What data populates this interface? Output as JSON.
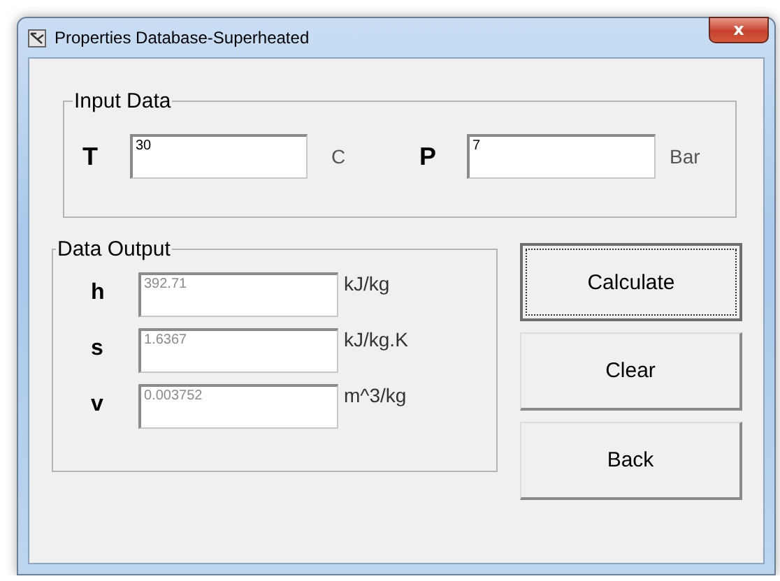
{
  "window": {
    "title": "Properties Database-Superheated",
    "close": "x"
  },
  "input_data": {
    "title": "Input Data",
    "fields": [
      {
        "label": "T",
        "value": "30",
        "unit": "C"
      },
      {
        "label": "P",
        "value": "7",
        "unit": "Bar"
      }
    ]
  },
  "data_output": {
    "title": "Data Output",
    "fields": [
      {
        "label": "h",
        "value": "392.71",
        "unit": "kJ/kg",
        "disabled": true
      },
      {
        "label": "s",
        "value": "1.6367",
        "unit": "kJ/kg.K",
        "disabled": true
      },
      {
        "label": "v",
        "value": "0.003752",
        "unit": "m^3/kg",
        "disabled": true
      }
    ]
  },
  "buttons": [
    {
      "label": "Calculate",
      "focused": true
    },
    {
      "label": "Clear",
      "focused": false
    },
    {
      "label": "Back",
      "focused": false
    }
  ]
}
